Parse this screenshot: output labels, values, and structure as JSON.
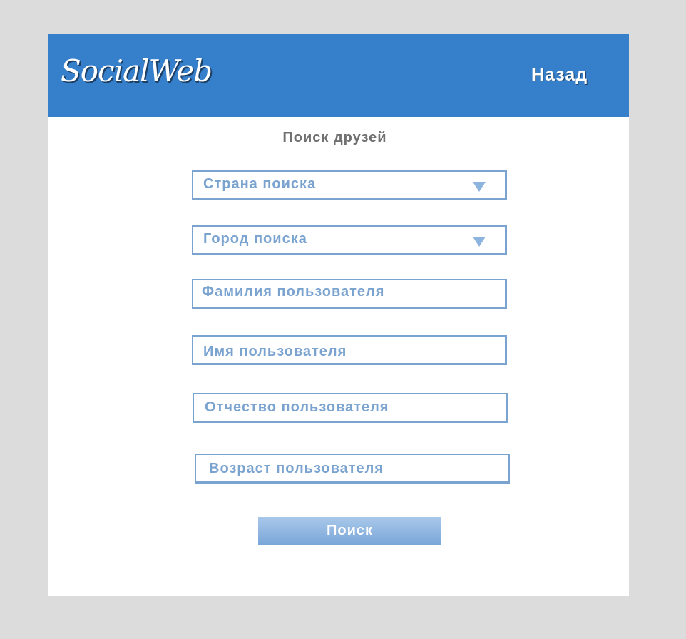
{
  "header": {
    "logo": "SocialWeb",
    "back_label": "Назад",
    "background_color": "#367fcb"
  },
  "page": {
    "title": "Поиск друзей"
  },
  "form": {
    "country_select": {
      "label": "Страна поиска",
      "icon": "triangle-down-icon"
    },
    "city_select": {
      "label": "Город поиска",
      "icon": "triangle-down-icon"
    },
    "last_name": {
      "label": "Фамилия пользователя"
    },
    "first_name": {
      "label": "Имя пользователя"
    },
    "patronymic": {
      "label": "Отчество пользователя"
    },
    "age": {
      "label": "Возраст пользователя"
    },
    "submit_label": "Поиск"
  },
  "colors": {
    "accent": "#367fcb",
    "field_border": "#7aa3d0",
    "page_background": "#dcdcdc"
  }
}
